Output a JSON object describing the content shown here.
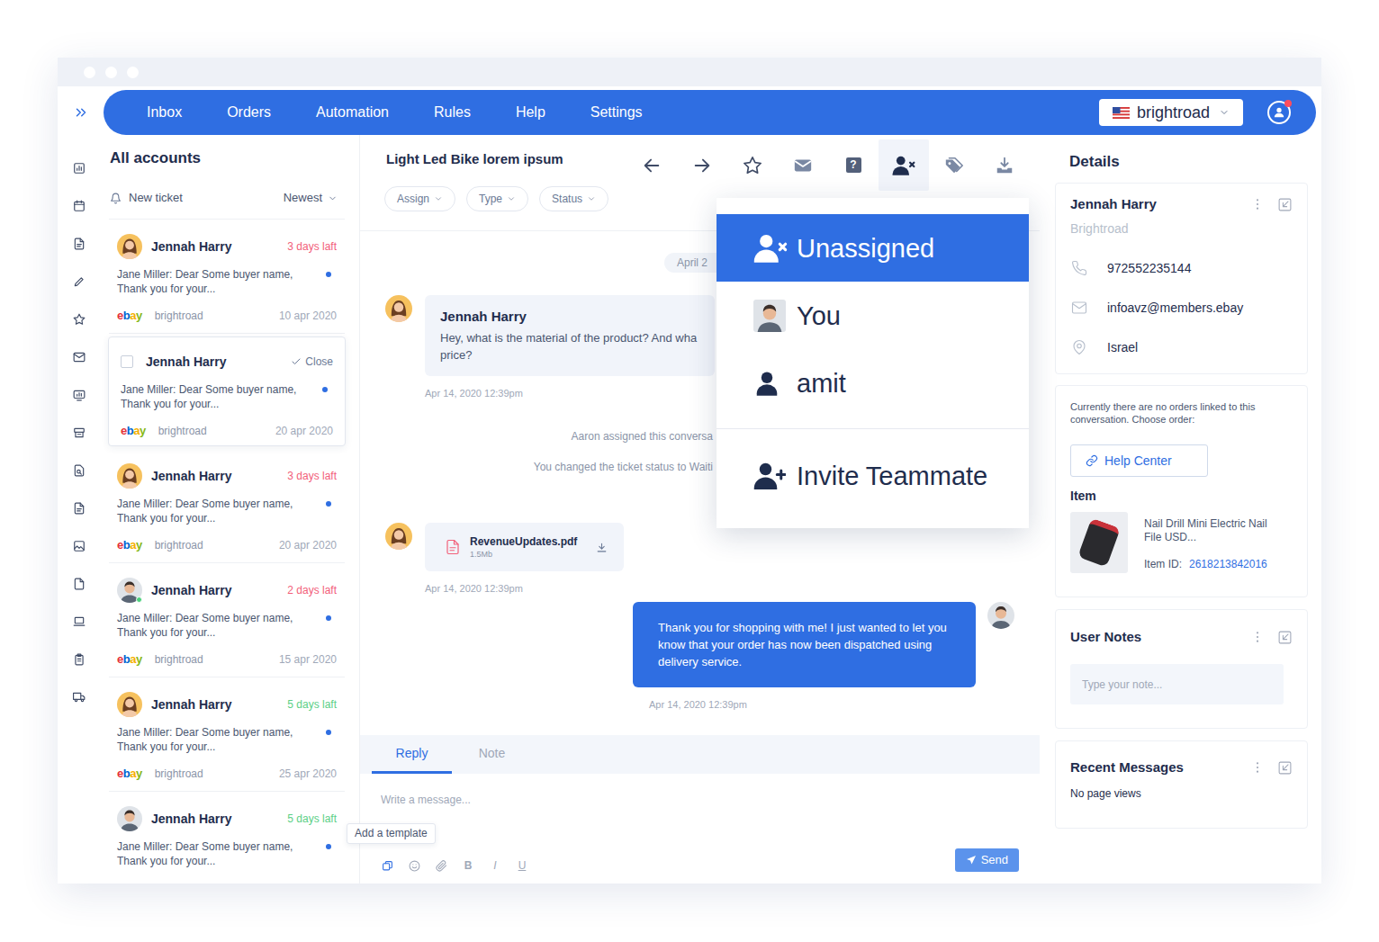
{
  "nav": {
    "items": [
      {
        "label": "Inbox"
      },
      {
        "label": "Orders"
      },
      {
        "label": "Automation"
      },
      {
        "label": "Rules"
      },
      {
        "label": "Help"
      },
      {
        "label": "Settings"
      }
    ],
    "account": "brightroad",
    "notification": true
  },
  "list": {
    "title": "All accounts",
    "new_ticket": "New ticket",
    "sort": "Newest",
    "tickets": [
      {
        "kind": "woman",
        "name": "Jennah Harry",
        "due": "3 days laft",
        "color": "#f2607a",
        "preview": [
          "Jane Miller: Dear Some buyer name,",
          "Thank you for your..."
        ],
        "unread": true,
        "source": "ebay",
        "account": "brightroad",
        "date": "10 apr 2020",
        "online": false,
        "selected": false
      },
      {
        "name": "Jennah Harry",
        "action": "Close",
        "checked": false,
        "preview": [
          "Jane Miller: Dear Some buyer name,",
          "Thank you for your..."
        ],
        "unread": true,
        "source": "ebay",
        "account": "brightroad",
        "date": "20 apr 2020",
        "selected": true
      },
      {
        "kind": "woman",
        "name": "Jennah Harry",
        "due": "3 days laft",
        "color": "#f2607a",
        "preview": [
          "Jane Miller: Dear Some buyer name,",
          "Thank you for your..."
        ],
        "unread": true,
        "source": "ebay",
        "account": "brightroad",
        "date": "20 apr 2020",
        "online": false,
        "selected": false
      },
      {
        "kind": "man",
        "name": "Jennah Harry",
        "due": "2 days laft",
        "color": "#f2607a",
        "preview": [
          "Jane Miller: Dear Some buyer name,",
          "Thank you for your..."
        ],
        "unread": true,
        "source": "ebay",
        "account": "brightroad",
        "date": "15 apr 2020",
        "online": true,
        "selected": false
      },
      {
        "kind": "woman",
        "name": "Jennah Harry",
        "due": "5 days laft",
        "color": "#5ccf86",
        "preview": [
          "Jane Miller: Dear Some buyer name,",
          "Thank you for your..."
        ],
        "unread": true,
        "source": "ebay",
        "account": "brightroad",
        "date": "25 apr 2020",
        "online": false,
        "selected": false
      },
      {
        "kind": "man",
        "name": "Jennah Harry",
        "due": "5 days laft",
        "color": "#5ccf86",
        "preview": [
          "Jane Miller: Dear Some buyer name,",
          "Thank you for your..."
        ],
        "unread": true,
        "online": false,
        "selected": false
      }
    ]
  },
  "conversation": {
    "subject": "Light Led Bike lorem ipsum",
    "toolbar": [
      {
        "kind": "back",
        "selected": false
      },
      {
        "kind": "forward",
        "selected": false
      },
      {
        "kind": "star",
        "selected": false
      },
      {
        "kind": "mail",
        "selected": false
      },
      {
        "kind": "help",
        "glyph": "?",
        "selected": false
      },
      {
        "kind": "assign",
        "selected": true
      },
      {
        "kind": "tag",
        "selected": false
      },
      {
        "kind": "download",
        "selected": false
      }
    ],
    "filters": [
      {
        "label": "Assign"
      },
      {
        "label": "Type"
      },
      {
        "label": "Status"
      }
    ],
    "date": "April 2",
    "timeline": [
      {
        "kind": "incoming",
        "author": "Jennah Harry",
        "lines": [
          "Hey, what is the material of the product?  And wha",
          "price?"
        ],
        "time": "Apr 14, 2020 12:39pm"
      },
      {
        "kind": "event",
        "text": "Aaron assigned this conversa"
      },
      {
        "kind": "event",
        "text": "You changed the ticket status to Waiti"
      },
      {
        "kind": "file",
        "file": "RevenueUpdates.pdf",
        "size": "1.5Mb",
        "time": "Apr 14, 2020 12:39pm"
      },
      {
        "kind": "outgoing",
        "text": "Thank you for shopping with me! I just wanted to let you know that your order has now been dispatched using  delivery service.",
        "time": "Apr 14, 2020 12:39pm"
      }
    ],
    "composer": {
      "tabs": [
        {
          "label": "Reply",
          "selected": true
        },
        {
          "label": "Note",
          "selected": false
        }
      ],
      "placeholder": "Write a message...",
      "tooltip": "Add a template",
      "format": [
        {
          "kind": "template"
        },
        {
          "kind": "emoji"
        },
        {
          "kind": "attach"
        },
        {
          "kind": "bold",
          "glyph": "B"
        },
        {
          "kind": "italic",
          "glyph": "I"
        },
        {
          "kind": "underline",
          "glyph": "U"
        }
      ],
      "send": "Send"
    }
  },
  "assign_menu": {
    "options": [
      {
        "label": "Unassigned",
        "kind": "unassigned",
        "selected": true
      },
      {
        "label": "You",
        "kind": "avatar",
        "selected": false
      },
      {
        "label": "amit",
        "kind": "user",
        "selected": false
      }
    ],
    "invite": "Invite Teammate"
  },
  "details": {
    "title": "Details",
    "contact": {
      "name": "Jennah Harry",
      "company": "Brightroad",
      "fields": [
        {
          "kind": "phone",
          "value": "972552235144"
        },
        {
          "kind": "email",
          "value": "infoavz@members.ebay"
        },
        {
          "kind": "location",
          "value": "Israel"
        }
      ]
    },
    "orders": {
      "note": "Currently there are no orders linked to this conversation. Choose order:",
      "button": "Help Center",
      "item_label": "Item",
      "item_name": "Nail Drill Mini Electric Nail File USD...",
      "item_id_label": "Item ID:",
      "item_id": "2618213842016"
    },
    "notes": {
      "title": "User Notes",
      "placeholder": "Type your note..."
    },
    "recent": {
      "title": "Recent Messages",
      "text": "No page views"
    }
  }
}
